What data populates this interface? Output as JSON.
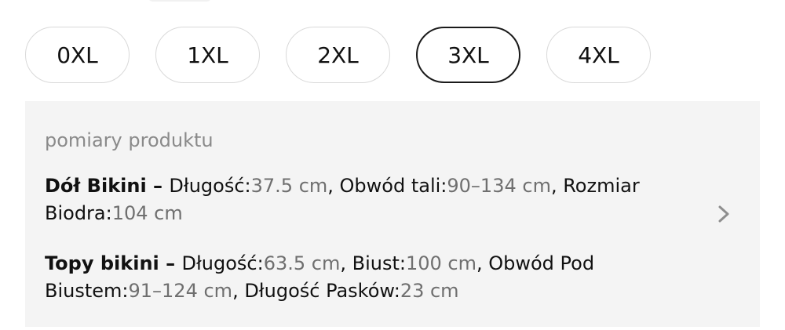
{
  "sizes": [
    {
      "label": "0XL",
      "selected": false
    },
    {
      "label": "1XL",
      "selected": false
    },
    {
      "label": "2XL",
      "selected": false
    },
    {
      "label": "3XL",
      "selected": true
    },
    {
      "label": "4XL",
      "selected": false
    }
  ],
  "measurements": {
    "heading": "pomiary produktu",
    "bottom": {
      "name": "Dół Bikini",
      "separator": " – ",
      "length_label": "Długość:",
      "length_value": "37.5 cm",
      "waist_label": ", Obwód tali:",
      "waist_value": "90–134 cm",
      "hip_label": ", Rozmiar Biodra:",
      "hip_value": "104 cm"
    },
    "top": {
      "name": "Topy bikini",
      "separator": " – ",
      "length_label": "Długość:",
      "length_value": "63.5 cm",
      "bust_label": ", Biust:",
      "bust_value": "100 cm",
      "underbust_label": ", Obwód Pod Biustem:",
      "underbust_value": "91–124 cm",
      "strap_label": ", Długość Pasków:",
      "strap_value": "23 cm"
    },
    "chevron_icon": "chevron-right-icon"
  }
}
